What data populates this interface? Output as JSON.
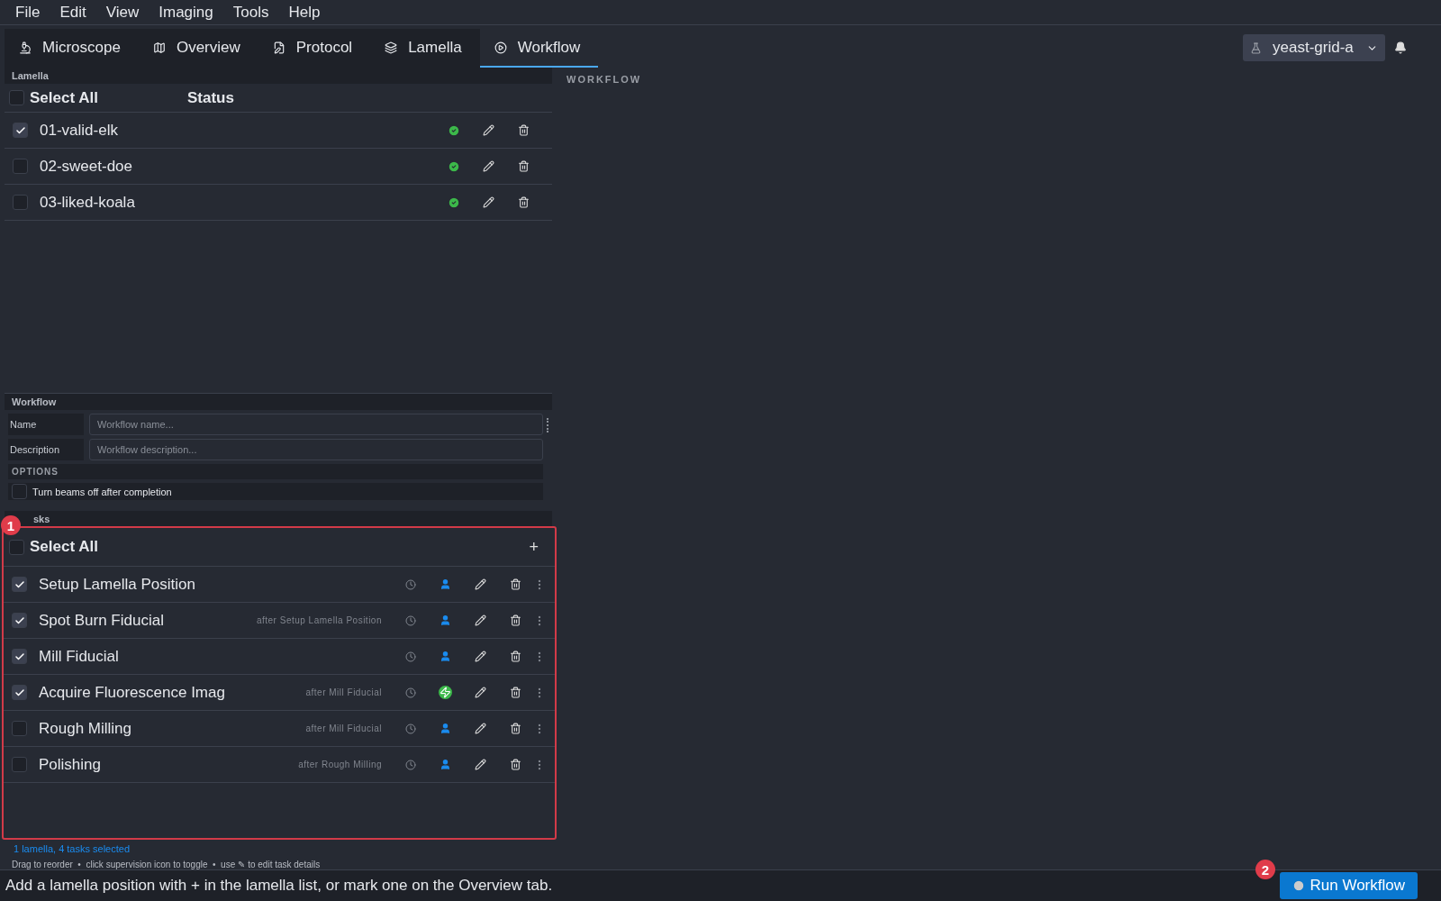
{
  "menu": [
    "File",
    "Edit",
    "View",
    "Imaging",
    "Tools",
    "Help"
  ],
  "tabs": [
    {
      "label": "Microscope",
      "selected": false
    },
    {
      "label": "Overview",
      "selected": false
    },
    {
      "label": "Protocol",
      "selected": false
    },
    {
      "label": "Lamella",
      "selected": false
    },
    {
      "label": "Workflow",
      "selected": true
    }
  ],
  "experiment": {
    "value": "yeast-grid-a"
  },
  "lamella_panel": {
    "title": "Lamella",
    "select_all": {
      "label": "Select All",
      "checked": false
    },
    "status_header": "Status",
    "rows": [
      {
        "name": "01-valid-elk",
        "checked": true,
        "ok": true
      },
      {
        "name": "02-sweet-doe",
        "checked": false,
        "ok": true
      },
      {
        "name": "03-liked-koala",
        "checked": false,
        "ok": true
      }
    ]
  },
  "workflow_header": "WORKFLOW",
  "workflow_form": {
    "title": "Workflow",
    "name_label": "Name",
    "name_placeholder": "Workflow name...",
    "description_label": "Description",
    "description_placeholder": "Workflow description...",
    "options_title": "OPTIONS",
    "option": {
      "label": "Turn beams off after completion",
      "checked": false
    }
  },
  "tasks": {
    "title": "sks",
    "select_all": {
      "label": "Select All",
      "checked": false
    },
    "add": "+",
    "rows": [
      {
        "name": "Setup Lamella Position",
        "checked": true,
        "supervised": true
      },
      {
        "name": "Spot Burn Fiducial",
        "after": "after Setup Lamella Position",
        "checked": true,
        "supervised": true
      },
      {
        "name": "Mill Fiducial",
        "checked": true,
        "supervised": true
      },
      {
        "name": "Acquire Fluorescence Imag",
        "after": "after Mill Fiducial",
        "checked": true,
        "supervised": false
      },
      {
        "name": "Rough Milling",
        "after": "after Mill Fiducial",
        "checked": false,
        "supervised": true
      },
      {
        "name": "Polishing",
        "after": "after Rough Milling",
        "checked": false,
        "supervised": true
      }
    ]
  },
  "selection_summary": "1 lamella, 4 tasks selected",
  "hint": "Drag to reorder  •  click supervision icon to toggle  •  use ✎ to edit task details",
  "status_bar": {
    "message": "Add a lamella position with + in the lamella list, or mark one on the Overview tab.",
    "run_button": "Run Workflow"
  },
  "annotations": [
    {
      "number": "1"
    },
    {
      "number": "2"
    }
  ]
}
